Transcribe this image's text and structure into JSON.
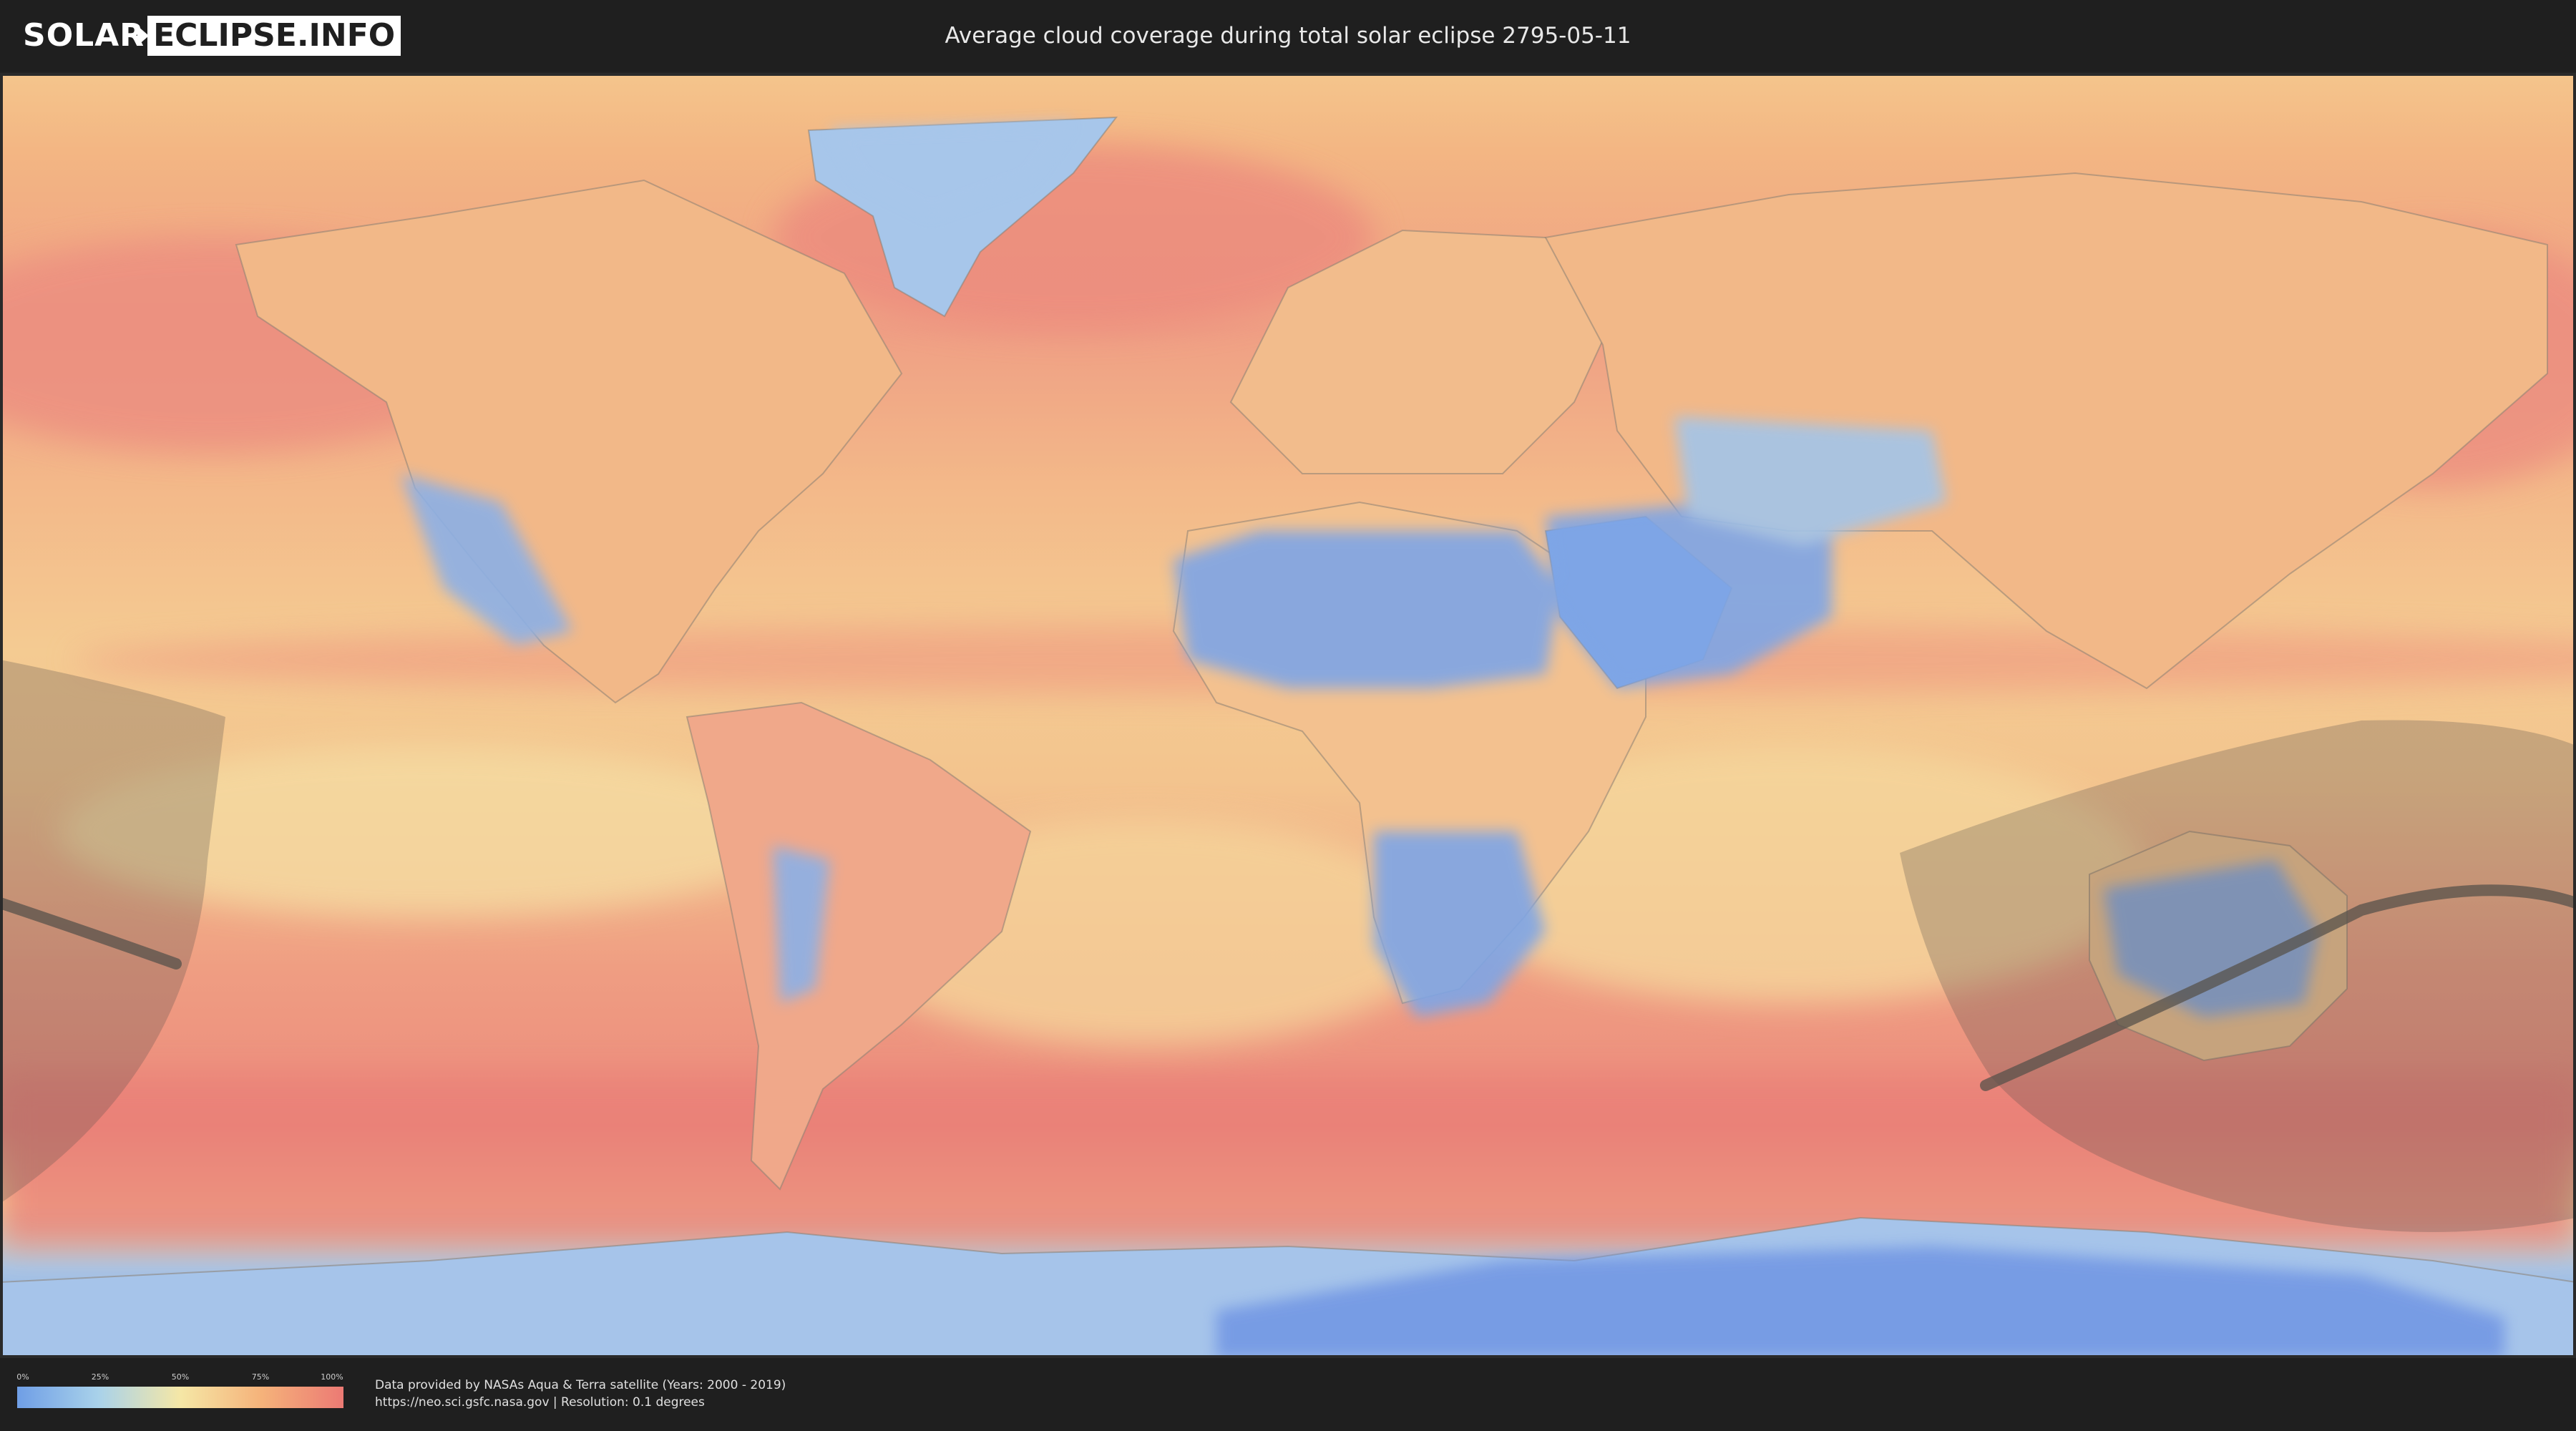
{
  "header": {
    "logo_left": "SOLAR",
    "logo_right": "ECLIPSE.INFO",
    "title": "Average cloud coverage during total solar eclipse 2795-05-11"
  },
  "map": {
    "colors": {
      "ocean_cloudy": "#ee9a82",
      "land_clear": "#7fa6e6",
      "mid": "#f5cf8e",
      "shadow": "#555047",
      "path_line": "#5a554d"
    }
  },
  "legend": {
    "ticks": [
      "0%",
      "25%",
      "50%",
      "75%",
      "100%"
    ],
    "gradient": [
      "#6f9ee6",
      "#a9d2ea",
      "#f5e7a6",
      "#f5b27a",
      "#ec7a74"
    ]
  },
  "credits": {
    "line1": "Data provided by NASAs Aqua & Terra satellite (Years: 2000 - 2019)",
    "line2": "https://neo.sci.gsfc.nasa.gov | Resolution: 0.1 degrees"
  }
}
